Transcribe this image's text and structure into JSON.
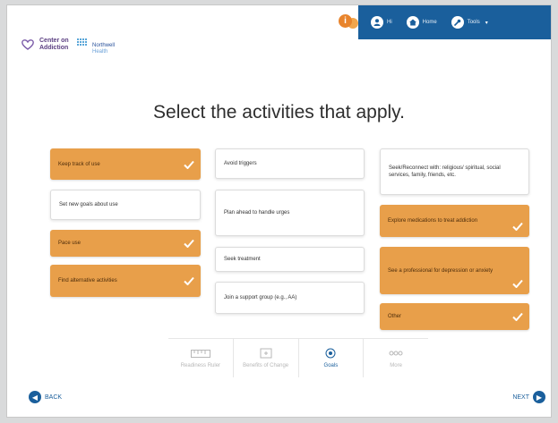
{
  "header": {
    "chat_badge": "i",
    "nav": [
      {
        "icon": "user-icon",
        "label": "Hi"
      },
      {
        "icon": "home-icon",
        "label": "Home"
      },
      {
        "icon": "wrench-icon",
        "label": "Tools",
        "caret": "▾"
      }
    ]
  },
  "logo": {
    "line1": "Center on",
    "line2": "Addiction",
    "partner1": "Northwell",
    "partner2": "Health"
  },
  "title": "Select the activities that apply.",
  "activities": {
    "col1": [
      {
        "label": "Keep track of use",
        "selected": true
      },
      {
        "label": "Set new goals about use",
        "selected": false
      },
      {
        "label": "Pace use",
        "selected": true
      },
      {
        "label": "Find alternative activities",
        "selected": true
      }
    ],
    "col2": [
      {
        "label": "Avoid triggers",
        "selected": false
      },
      {
        "label": "Plan ahead to handle urges",
        "selected": false
      },
      {
        "label": "Seek treatment",
        "selected": false
      },
      {
        "label": "Join a support group (e.g., AA)",
        "selected": false
      }
    ],
    "col3": [
      {
        "label": "Seek/Reconnect with: religious/ spiritual, social services, family, friends, etc.",
        "selected": false
      },
      {
        "label": "Explore medications to treat addiction",
        "selected": true
      },
      {
        "label": "See a professional for depression or anxiety",
        "selected": true
      },
      {
        "label": "Other",
        "selected": true
      }
    ]
  },
  "steps": [
    {
      "label": "Readiness Ruler",
      "icon": "ruler-icon",
      "active": false
    },
    {
      "label": "Benefits of Change",
      "icon": "scale-icon",
      "active": false
    },
    {
      "label": "Goals",
      "icon": "target-icon",
      "active": true
    },
    {
      "label": "More",
      "icon": "more-icon",
      "active": false
    }
  ],
  "footer": {
    "back_label": "BACK",
    "next_label": "NEXT"
  },
  "colors": {
    "accent_blue": "#1a5f9c",
    "selected_orange": "#e89f4a",
    "brand_purple": "#5b3f82"
  }
}
